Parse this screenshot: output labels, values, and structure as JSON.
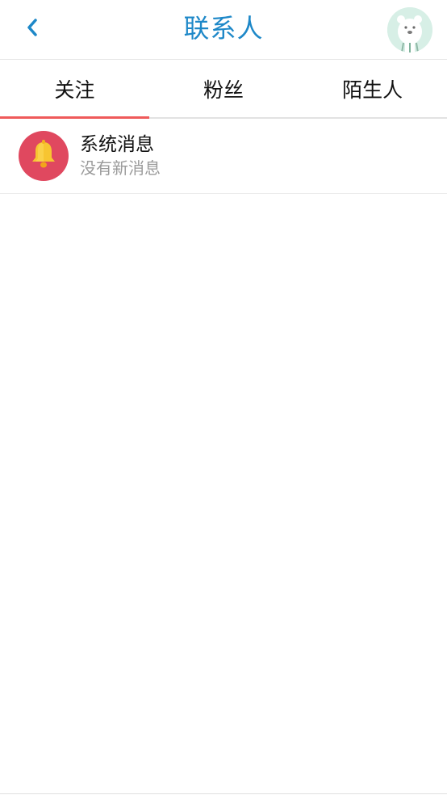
{
  "header": {
    "back_icon": "chevron-left-icon",
    "title": "联系人",
    "avatar_icon": "bear-avatar-icon"
  },
  "tabs": [
    {
      "label": "关注",
      "active": true
    },
    {
      "label": "粉丝",
      "active": false
    },
    {
      "label": "陌生人",
      "active": false
    }
  ],
  "list": [
    {
      "icon": "bell-icon",
      "title": "系统消息",
      "subtitle": "没有新消息"
    }
  ],
  "colors": {
    "accent_blue": "#1e88c8",
    "tab_indicator": "#ef5a5a",
    "bell_background": "#e0485f",
    "bell_fill": "#f7c531"
  }
}
